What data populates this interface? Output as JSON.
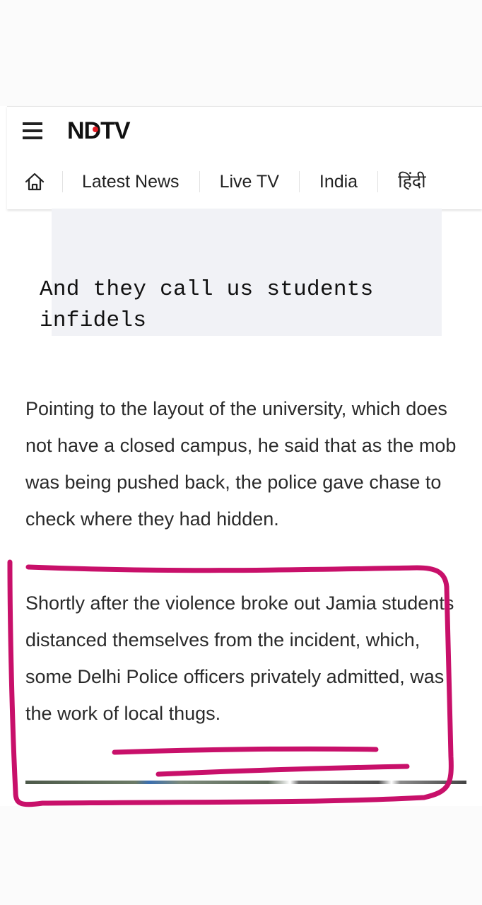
{
  "header": {
    "logo_text": "NDTV",
    "logo_dot_color": "#e31b23",
    "nav": {
      "home_icon": "home-icon",
      "items": [
        {
          "label": "Latest News"
        },
        {
          "label": "Live TV"
        },
        {
          "label": "India"
        },
        {
          "label": "हिंदी"
        }
      ]
    }
  },
  "article": {
    "quote": "And they call us students infidels",
    "paragraph1": "Pointing to the layout of the university, which does not have a closed campus, he said that as the mob was being pushed back, the police gave chase to check where they had hidden.",
    "paragraph2": "Shortly after the violence broke out Jamia students distanced themselves from the incident, which, some Delhi Police officers privately admitted, was the work of local thugs."
  },
  "annotation": {
    "color": "#c8106a"
  }
}
